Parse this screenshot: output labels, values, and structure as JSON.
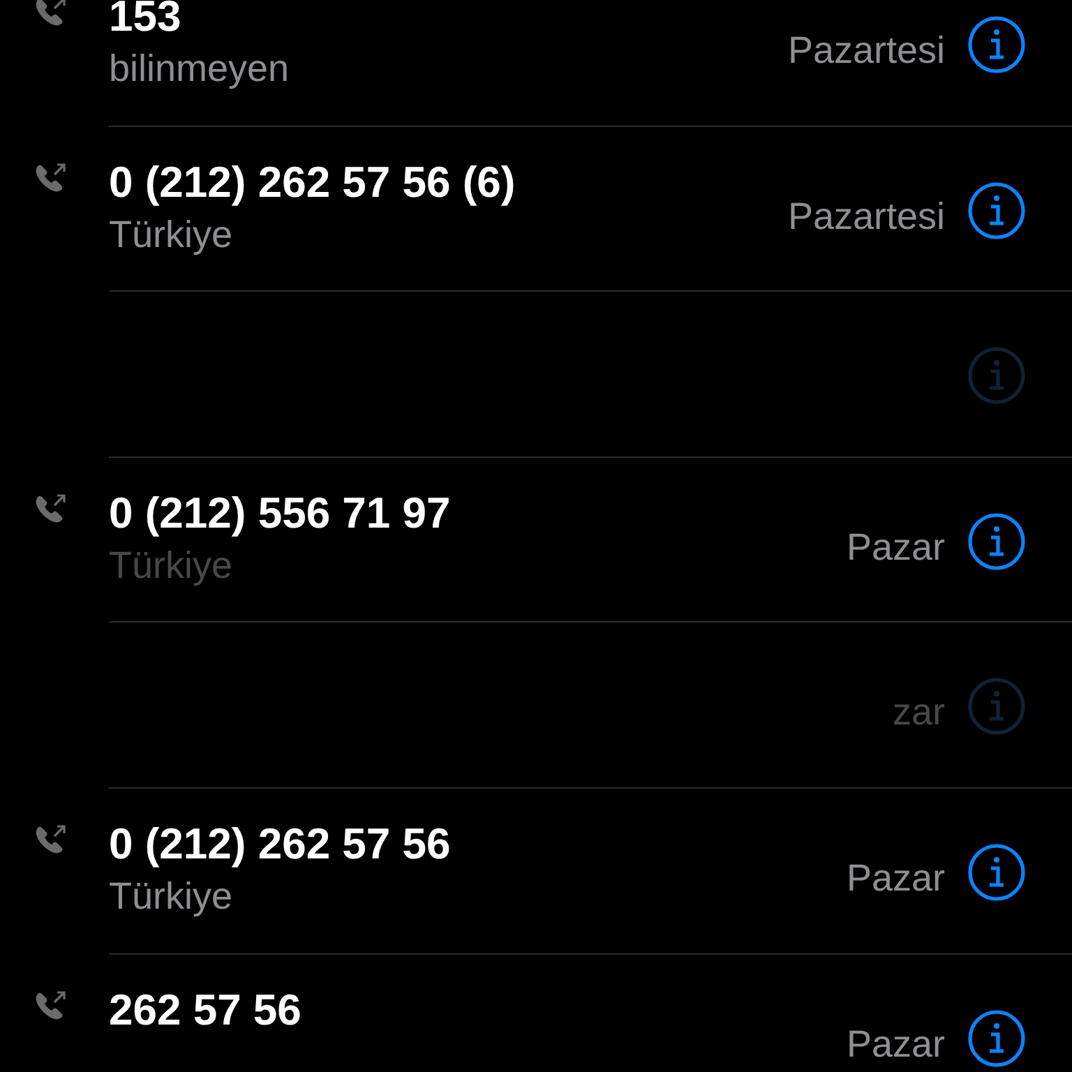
{
  "calls": [
    {
      "number": "153",
      "subtitle": "bilinmeyen",
      "day": "Pazartesi",
      "obscured": false
    },
    {
      "number": "0 (212) 262 57 56 (6)",
      "subtitle": "Türkiye",
      "day": "Pazartesi",
      "obscured": false
    },
    {
      "obscured": true
    },
    {
      "number": "0 (212) 556 71 97",
      "subtitle": "Türkiye",
      "day": "Pazar",
      "obscured": false,
      "subtitle_dimmed": true
    },
    {
      "day": "zar",
      "obscured": true
    },
    {
      "number": "0 (212) 262 57 56",
      "subtitle": "Türkiye",
      "day": "Pazar",
      "obscured": false
    },
    {
      "number": "262 57 56",
      "day": "Pazar",
      "obscured": false
    }
  ]
}
